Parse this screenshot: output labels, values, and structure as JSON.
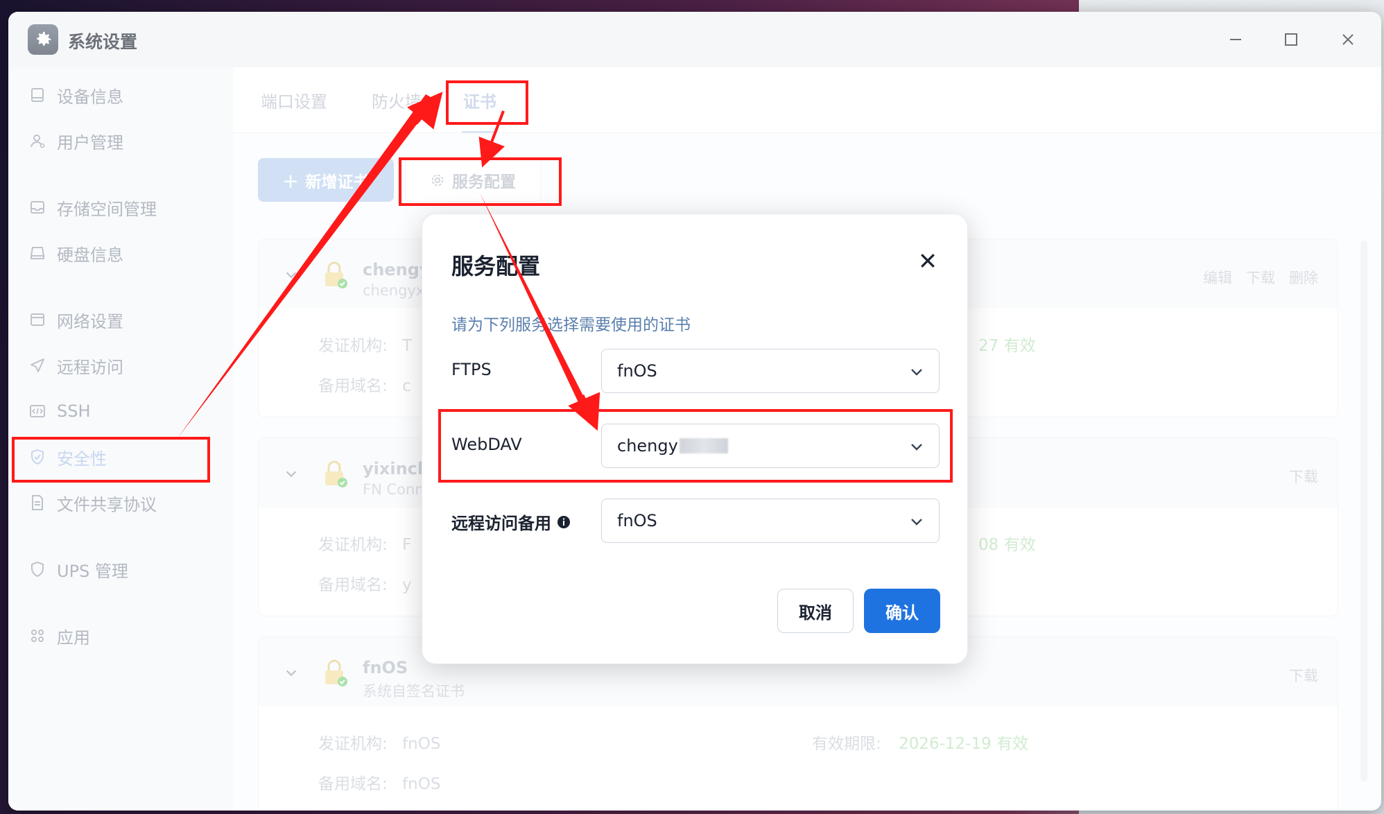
{
  "window": {
    "title": "系统设置",
    "minimize_symbol": "—",
    "maximize_symbol": "☐",
    "close_symbol": "✕"
  },
  "sidebar": {
    "items": [
      {
        "label": "设备信息",
        "icon": "device-icon"
      },
      {
        "label": "用户管理",
        "icon": "user-icon"
      },
      {
        "label": "存储空间管理",
        "icon": "storage-icon"
      },
      {
        "label": "硬盘信息",
        "icon": "disk-icon"
      },
      {
        "label": "网络设置",
        "icon": "network-icon"
      },
      {
        "label": "远程访问",
        "icon": "send-icon"
      },
      {
        "label": "SSH",
        "icon": "code-icon"
      },
      {
        "label": "安全性",
        "icon": "shield-check-icon",
        "active": true
      },
      {
        "label": "文件共享协议",
        "icon": "file-icon"
      },
      {
        "label": "UPS 管理",
        "icon": "shield-icon"
      },
      {
        "label": "应用",
        "icon": "apps-icon"
      }
    ]
  },
  "tabs": {
    "port": "端口设置",
    "firewall": "防火墙",
    "cert": "证书"
  },
  "toolbar": {
    "add_label": "新增证书",
    "service_label": "服务配置"
  },
  "cards": [
    {
      "title": "chengyx",
      "subtitle": "chengyx.s",
      "actions": [
        "编辑",
        "下载",
        "删除"
      ],
      "issuer_label": "发证机构:",
      "issuer_value": "T",
      "domain_label": "备用域名:",
      "domain_value": "c",
      "valid_value": "27 有效"
    },
    {
      "title": "yixinche",
      "subtitle": "FN Conn",
      "actions": [
        "下载"
      ],
      "issuer_label": "发证机构:",
      "issuer_value": "F",
      "domain_label": "备用域名:",
      "domain_value": "y",
      "valid_value": "08 有效"
    },
    {
      "title": "fnOS",
      "subtitle": "系统自签名证书",
      "actions": [
        "下载"
      ],
      "issuer_label": "发证机构:",
      "issuer_value": "fnOS",
      "domain_label": "备用域名:",
      "domain_value": "fnOS",
      "valid_label": "有效期限:",
      "valid_value": "2026-12-19 有效"
    }
  ],
  "dialog": {
    "title": "服务配置",
    "hint": "请为下列服务选择需要使用的证书",
    "fields": [
      {
        "label": "FTPS",
        "value": "fnOS"
      },
      {
        "label": "WebDAV",
        "value": "chengy"
      },
      {
        "label": "远程访问备用",
        "value": "fnOS"
      }
    ],
    "cancel_label": "取消",
    "ok_label": "确认"
  },
  "colors": {
    "accent": "#1f73e0",
    "annotation": "#ff1a1a"
  }
}
